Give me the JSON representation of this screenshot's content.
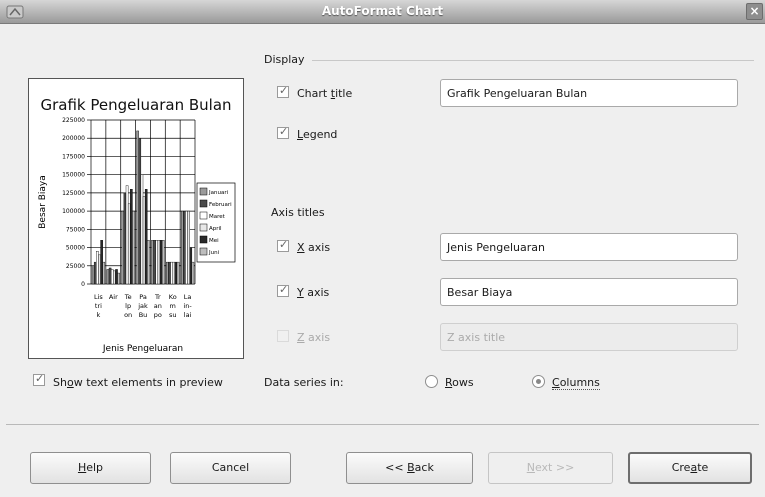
{
  "window": {
    "title": "AutoFormat Chart",
    "close_glyph": "×"
  },
  "display": {
    "section_label": "Display",
    "chart_title": {
      "label_pre": "Chart ",
      "label_ul": "t",
      "label_post": "itle",
      "checked": true,
      "value": "Grafik Pengeluaran Bulan"
    },
    "legend": {
      "label_pre": "",
      "label_ul": "L",
      "label_post": "egend",
      "checked": true
    }
  },
  "axis_titles": {
    "section_label": "Axis titles",
    "x": {
      "label_pre": "",
      "label_ul": "X",
      "label_post": " axis",
      "checked": true,
      "value": "Jenis Pengeluaran"
    },
    "y": {
      "label_pre": "",
      "label_ul": "Y",
      "label_post": " axis",
      "checked": true,
      "value": "Besar Biaya"
    },
    "z": {
      "label_pre": "",
      "label_ul": "Z",
      "label_post": " axis",
      "checked": false,
      "placeholder": "Z axis title"
    }
  },
  "show_text": {
    "label_pre": "Sh",
    "label_ul": "o",
    "label_post": "w text elements in preview",
    "checked": true
  },
  "data_series": {
    "label": "Data series in:",
    "rows": {
      "label_pre": "",
      "label_ul": "R",
      "label_post": "ows",
      "selected": false
    },
    "columns": {
      "label_pre": "",
      "label_ul": "C",
      "label_post": "olumns",
      "selected": true
    }
  },
  "buttons": {
    "help": {
      "pre": "",
      "ul": "H",
      "post": "elp"
    },
    "cancel": {
      "pre": "Cancel",
      "ul": "",
      "post": ""
    },
    "back": {
      "pre": "<< ",
      "ul": "B",
      "post": "ack"
    },
    "next": {
      "pre": "",
      "ul": "N",
      "post": "ext >>"
    },
    "create": {
      "pre": "Cre",
      "ul": "a",
      "post": "te"
    }
  },
  "chart_data": {
    "type": "bar",
    "title": "Grafik Pengeluaran Bulan",
    "xlabel": "Jenis Pengeluaran",
    "ylabel": "Besar Biaya",
    "ylim": [
      0,
      225000
    ],
    "yticks": [
      "225000",
      "200000",
      "175000",
      "150000",
      "125000",
      "100000",
      "75000",
      "50000",
      "25000",
      "0"
    ],
    "categories": [
      "Lis tri k",
      "Air",
      "Te lp",
      "Pa jak on",
      "Tr an Bu",
      "Ko m po",
      "La in- su",
      "lai"
    ],
    "category_labels": [
      [
        "Lis",
        "tri",
        "k"
      ],
      [
        "Air",
        "",
        ""
      ],
      [
        "Te",
        "lp",
        "on"
      ],
      [
        "Pa",
        "jak",
        "Bu"
      ],
      [
        "Tr",
        "an",
        "po"
      ],
      [
        "Ko",
        "m",
        "su"
      ],
      [
        "La",
        "in-",
        "lai"
      ]
    ],
    "legend": [
      "Januari",
      "Februari",
      "Maret",
      "April",
      "Mei",
      "Juni"
    ],
    "legend_colors": [
      "#9a9a9a",
      "#4a4a4a",
      "#ffffff",
      "#e8e8e8",
      "#2a2a2a",
      "#bdbdbd"
    ],
    "series": [
      {
        "name": "Januari",
        "values": [
          25000,
          20000,
          100000,
          210000,
          60000,
          30000,
          100000
        ]
      },
      {
        "name": "Februari",
        "values": [
          30000,
          22000,
          125000,
          200000,
          60000,
          30000,
          100000
        ]
      },
      {
        "name": "Maret",
        "values": [
          45000,
          20000,
          135000,
          150000,
          60000,
          30000,
          100000
        ]
      },
      {
        "name": "April",
        "values": [
          40000,
          18000,
          110000,
          120000,
          60000,
          30000,
          100000
        ]
      },
      {
        "name": "Mei",
        "values": [
          60000,
          20000,
          130000,
          130000,
          60000,
          30000,
          50000
        ]
      },
      {
        "name": "Juni",
        "values": [
          30000,
          15000,
          100000,
          60000,
          60000,
          30000,
          30000
        ]
      }
    ]
  }
}
